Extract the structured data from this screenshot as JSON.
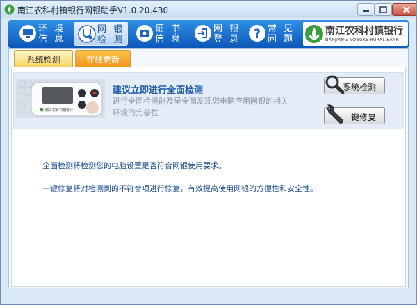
{
  "window": {
    "title": "南江农科村镇银行网银助手V1.0.20.430",
    "controls": [
      "minimize",
      "maximize",
      "close"
    ]
  },
  "nav": {
    "items": [
      {
        "label": "环 境\n信 息",
        "icon": "computer-icon",
        "active": false
      },
      {
        "label": "网 银\n检 测",
        "icon": "stethoscope-icon",
        "active": true
      },
      {
        "label": "证 书\n信 息",
        "icon": "certificate-icon",
        "active": false
      },
      {
        "label": "网 银\n登 录",
        "icon": "login-icon",
        "active": false
      },
      {
        "label": "常 见\n问 题",
        "icon": "question-icon",
        "active": false
      }
    ]
  },
  "brand": {
    "name_cn": "南江农科村镇银行",
    "name_en": "NANJIANG NONGKE RURAL BANK",
    "color": "#3b9d3b"
  },
  "tabs": [
    {
      "label": "系统检测",
      "selected": true
    },
    {
      "label": "在线更新",
      "selected": false
    }
  ],
  "device": {
    "brand_text": "南江农科村镇银行"
  },
  "header": {
    "title": "建议立即进行全面检测",
    "desc": "进行全面检测能及早全面发现您电脑应用网银的相关环境的完善性"
  },
  "buttons": {
    "check": "系统检测",
    "repair": "一键修复"
  },
  "info": {
    "line1": "全面检测将检测您的电脑设置是否符合网银使用要求。",
    "line2": "一键修复将对检测到的不符合项进行修复，有效提高使用网银的方便性和安全性。"
  },
  "colors": {
    "toolbar": "#1570d0",
    "accent_text": "#1c57a8",
    "tab_active": "#f9d466",
    "tab_inactive": "#f1941c"
  }
}
